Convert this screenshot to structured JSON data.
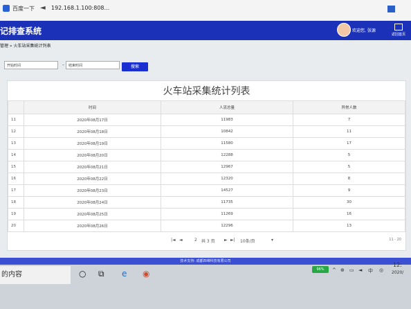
{
  "browser": {
    "tab_label": "百度一下",
    "back_glyph": "◄",
    "url": "192.168.1.100:808..."
  },
  "header": {
    "title": "记排查系统",
    "welcome": "欢迎您, 张源",
    "return_home": "返回首页"
  },
  "breadcrumb": "管理 » 火车站采集统计列表",
  "search": {
    "start_placeholder": "开始时间",
    "end_placeholder": "结束时间",
    "separator": "-",
    "button_label": "搜索"
  },
  "table": {
    "title": "火车站采集统计列表",
    "headers": [
      "",
      "时间",
      "人流总量",
      "异常人数"
    ],
    "rows": [
      {
        "idx": "11",
        "date": "2020年08月17日",
        "total": "11983",
        "abnormal": "7"
      },
      {
        "idx": "12",
        "date": "2020年08月18日",
        "total": "10842",
        "abnormal": "11"
      },
      {
        "idx": "13",
        "date": "2020年08月19日",
        "total": "11580",
        "abnormal": "17"
      },
      {
        "idx": "14",
        "date": "2020年08月20日",
        "total": "12288",
        "abnormal": "5"
      },
      {
        "idx": "15",
        "date": "2020年08月21日",
        "total": "12967",
        "abnormal": "5"
      },
      {
        "idx": "16",
        "date": "2020年08月22日",
        "total": "12320",
        "abnormal": "8"
      },
      {
        "idx": "17",
        "date": "2020年08月23日",
        "total": "14527",
        "abnormal": "9"
      },
      {
        "idx": "18",
        "date": "2020年08月24日",
        "total": "11735",
        "abnormal": "30"
      },
      {
        "idx": "19",
        "date": "2020年08月25日",
        "total": "11269",
        "abnormal": "16"
      },
      {
        "idx": "20",
        "date": "2020年08月26日",
        "total": "12296",
        "abnormal": "13"
      }
    ]
  },
  "pager": {
    "first": "|◄",
    "prev": "◄",
    "page": "2",
    "of_pages": "共 3 页",
    "next": "►",
    "last": "►|",
    "per_page": "10条/页",
    "dropdown_arrow": "▾",
    "range": "11 - 20"
  },
  "footer": {
    "text": "技术支持: 成都四维科技有限公司"
  },
  "taskbar": {
    "search_text": "的内容",
    "battery": "96%",
    "time": "12:",
    "date": "2020/"
  },
  "colors": {
    "header_bg": "#1a31b8",
    "search_button_bg": "#1a2fcf",
    "footer_bg": "#3b4fd2"
  }
}
